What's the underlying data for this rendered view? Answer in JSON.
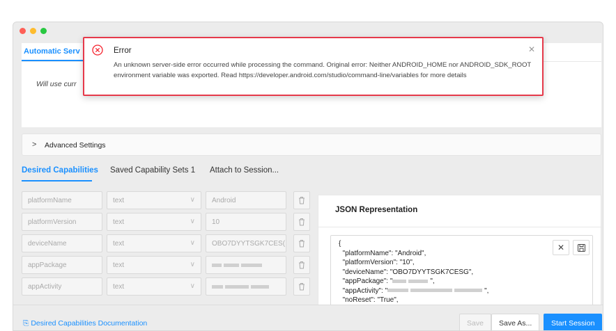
{
  "server": {
    "tab_label": "Automatic Serv",
    "body_text": "Will use curr"
  },
  "advanced": {
    "label": "Advanced Settings"
  },
  "cap_tabs": [
    {
      "label": "Desired Capabilities"
    },
    {
      "label": "Saved Capability Sets 1"
    },
    {
      "label": "Attach to Session..."
    }
  ],
  "capabilities": [
    {
      "name": "platformName",
      "type": "text",
      "value": "Android"
    },
    {
      "name": "platformVersion",
      "type": "text",
      "value": "10"
    },
    {
      "name": "deviceName",
      "type": "text",
      "value": "OBO7DYYTSGK7CES("
    },
    {
      "name": "appPackage",
      "type": "text",
      "value": ""
    },
    {
      "name": "appActivity",
      "type": "text",
      "value": ""
    }
  ],
  "json": {
    "title": "JSON Representation",
    "line0": "{",
    "line1": "\"platformName\": \"Android\",",
    "line2": "\"platformVersion\": \"10\",",
    "line3": "\"deviceName\": \"OBO7DYYTSGK7CESG\",",
    "line4": "\"appPackage\": \"",
    "line4_end": "\",",
    "line5": "\"appActivity\": \"",
    "line5_end": "\",",
    "line6": "\"noReset\": \"True\","
  },
  "footer": {
    "doc_link": "Desired Capabilities Documentation",
    "save": "Save",
    "save_as": "Save As...",
    "start": "Start Session"
  },
  "error": {
    "title": "Error",
    "message": "An unknown server-side error occurred while processing the command. Original error: Neither ANDROID_HOME nor ANDROID_SDK_ROOT environment variable was exported. Read https://developer.android.com/studio/command-line/variables for more details"
  },
  "colors": {
    "accent": "#1a90ff",
    "error": "#e6394a"
  }
}
